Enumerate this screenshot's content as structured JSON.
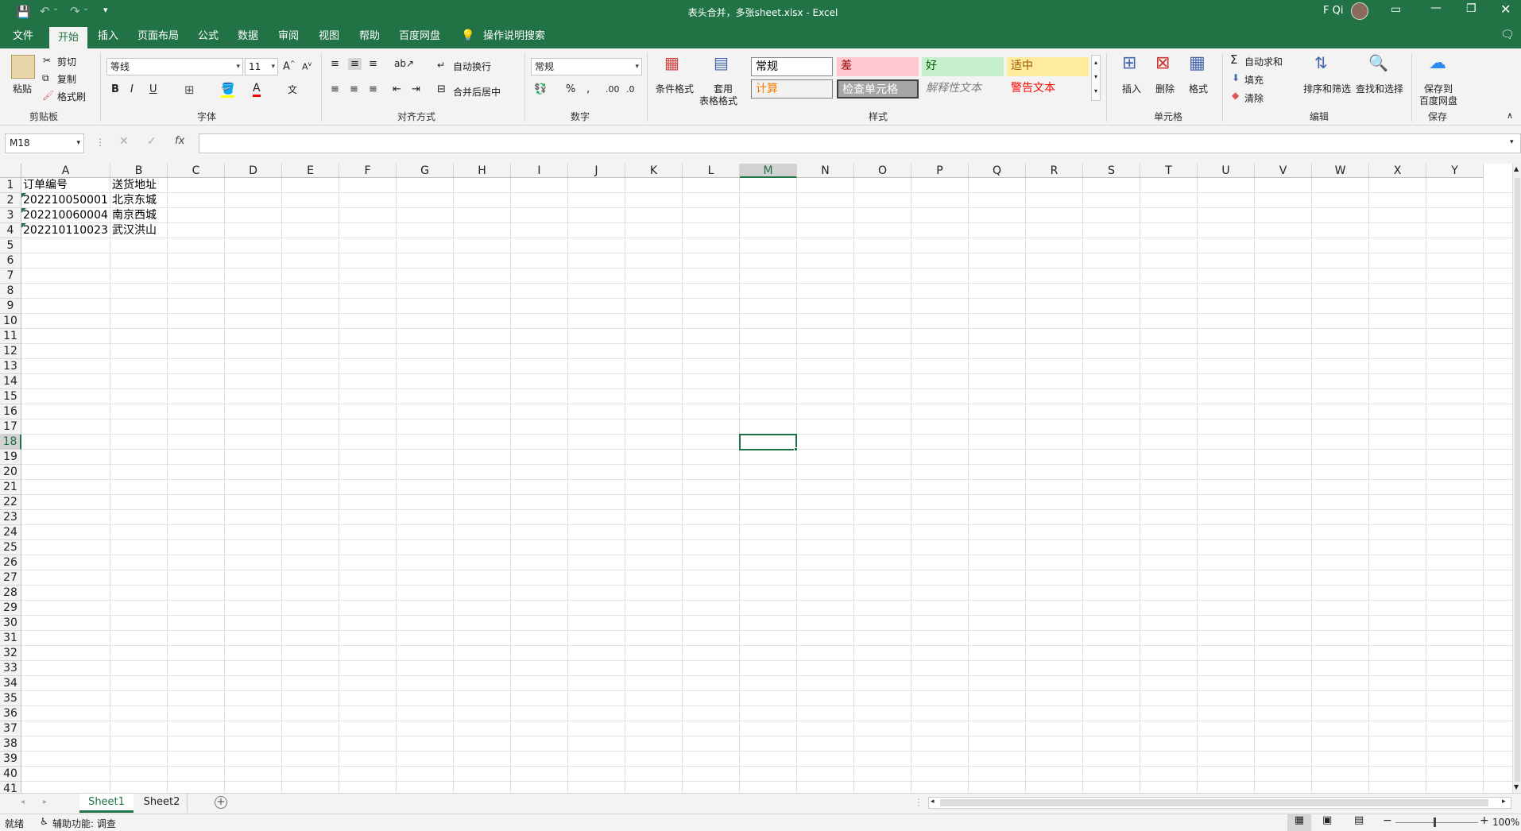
{
  "title": {
    "document": "表头合并，多张sheet.xlsx - Excel",
    "user": "F Qi"
  },
  "menu_tabs": [
    "文件",
    "开始",
    "插入",
    "页面布局",
    "公式",
    "数据",
    "审阅",
    "视图",
    "帮助",
    "百度网盘"
  ],
  "tell_me": "操作说明搜索",
  "ribbon": {
    "clipboard": {
      "paste": "粘贴",
      "cut": "剪切",
      "copy": "复制",
      "format_painter": "格式刷",
      "label": "剪贴板"
    },
    "font": {
      "name": "等线",
      "size": "11",
      "label": "字体"
    },
    "alignment": {
      "wrap": "自动换行",
      "merge": "合并后居中",
      "label": "对齐方式"
    },
    "number": {
      "format": "常规",
      "label": "数字"
    },
    "styles": {
      "conditional": "条件格式",
      "table_format_1": "套用",
      "table_format_2": "表格格式",
      "normal": "常规",
      "bad": "差",
      "good": "好",
      "neutral": "适中",
      "calculation": "计算",
      "check_cell": "检查单元格",
      "explanatory": "解释性文本",
      "warning": "警告文本",
      "label": "样式"
    },
    "cells": {
      "insert": "插入",
      "delete": "删除",
      "format": "格式",
      "label": "单元格"
    },
    "editing": {
      "autosum": "自动求和",
      "fill": "填充",
      "clear": "清除",
      "sort_filter": "排序和筛选",
      "find_select": "查找和选择",
      "label": "编辑"
    },
    "save": {
      "line1": "保存到",
      "line2": "百度网盘",
      "label": "保存"
    }
  },
  "formula_bar": {
    "name_box": "M18",
    "value": ""
  },
  "columns": [
    "A",
    "B",
    "C",
    "D",
    "E",
    "F",
    "G",
    "H",
    "I",
    "J",
    "K",
    "L",
    "M",
    "N",
    "O",
    "P",
    "Q",
    "R",
    "S",
    "T",
    "U",
    "V",
    "W",
    "X",
    "Y"
  ],
  "rows": [
    "1",
    "2",
    "3",
    "4",
    "5",
    "6",
    "7",
    "8",
    "9",
    "10",
    "11",
    "12",
    "13",
    "14",
    "15",
    "16",
    "17",
    "18",
    "19",
    "20",
    "21",
    "22",
    "23",
    "24",
    "25",
    "26",
    "27",
    "28",
    "29",
    "30",
    "31",
    "32",
    "33",
    "34",
    "35",
    "36",
    "37",
    "38",
    "39",
    "40",
    "41"
  ],
  "cells": [
    [
      "订单编号",
      "送货地址"
    ],
    [
      "202210050001",
      "北京东城"
    ],
    [
      "202210060004",
      "南京西城"
    ],
    [
      "202210110023",
      "武汉洪山"
    ]
  ],
  "active_cell": "M18",
  "sheets": [
    "Sheet1",
    "Sheet2"
  ],
  "active_sheet": "Sheet1",
  "status": {
    "ready": "就绪",
    "accessibility": "辅助功能: 调查",
    "zoom": "100%"
  },
  "colors": {
    "brand": "#217346",
    "selection": "#1e7145"
  }
}
